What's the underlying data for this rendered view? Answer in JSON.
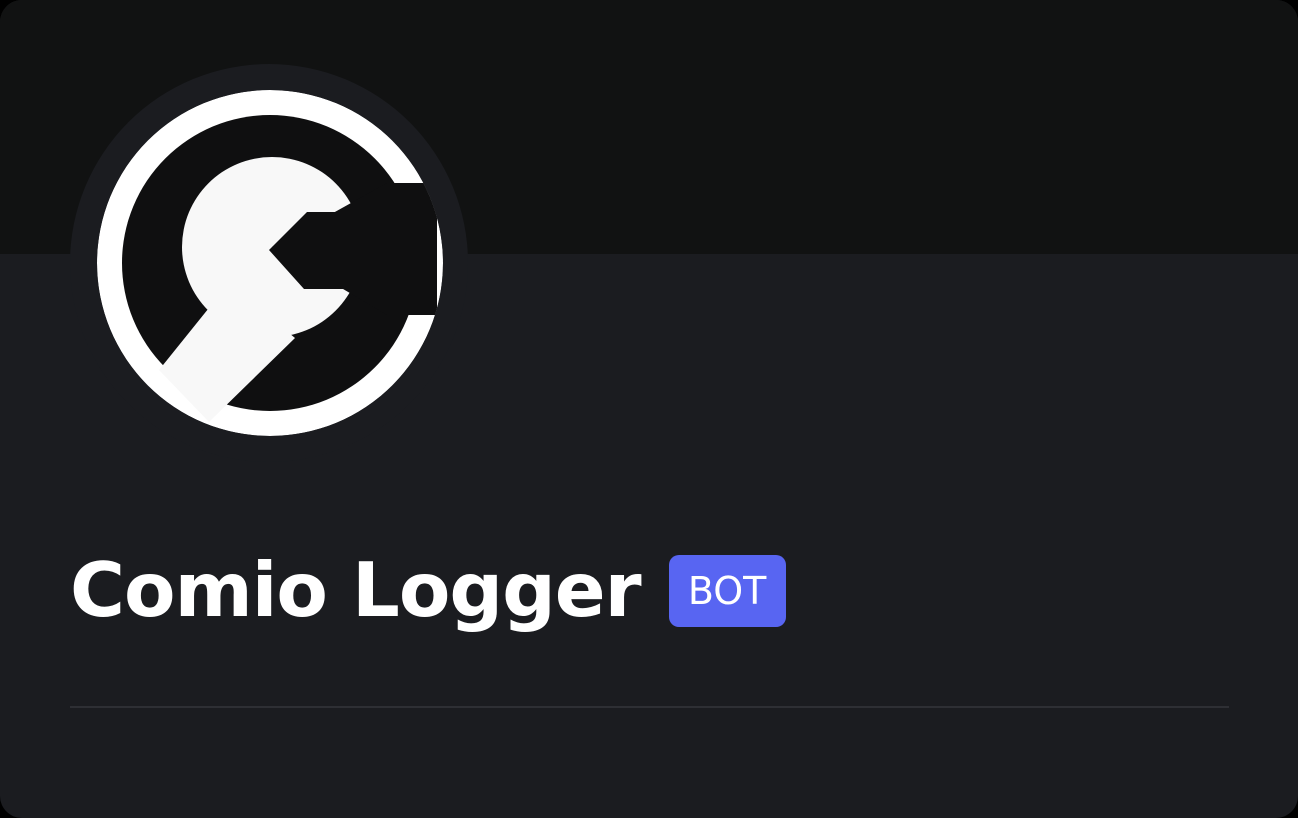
{
  "profile": {
    "display_name": "Comio Logger",
    "badge": "BOT",
    "avatar_icon": "wrench-icon"
  },
  "colors": {
    "banner": "#111212",
    "card_background": "#1b1c20",
    "badge_background": "#5865f2",
    "divider": "#2e2f34",
    "avatar_ring": "#ffffff",
    "avatar_fill": "#0f0f10",
    "text": "#ffffff"
  }
}
